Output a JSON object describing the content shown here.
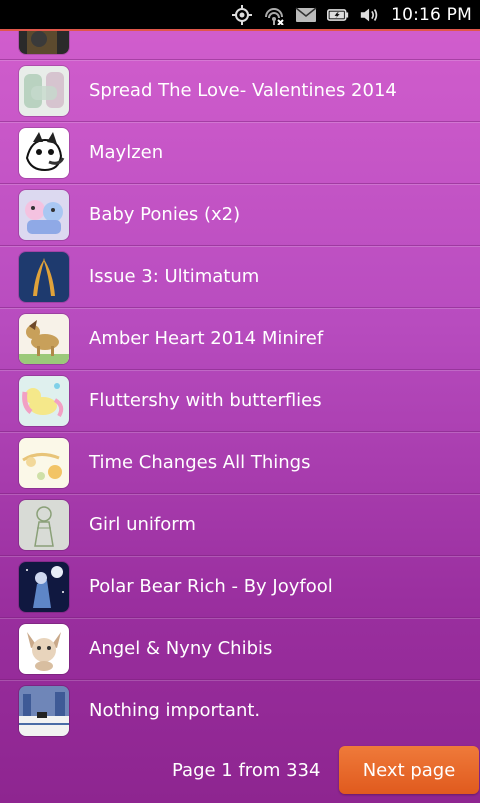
{
  "status_bar": {
    "time": "10:16 PM",
    "icons": [
      "location-icon",
      "network-icon",
      "mail-icon",
      "battery-icon",
      "volume-icon"
    ]
  },
  "list": {
    "items": [
      {
        "title": "",
        "thumb": "dark-art"
      },
      {
        "title": "Spread The Love- Valentines 2014",
        "thumb": "blurred-pastel"
      },
      {
        "title": "Maylzen",
        "thumb": "black-white-pony"
      },
      {
        "title": "Baby Ponies (x2)",
        "thumb": "colorful-ponies"
      },
      {
        "title": "Issue 3: Ultimatum",
        "thumb": "dark-blue-gold"
      },
      {
        "title": "Amber Heart 2014 Miniref",
        "thumb": "brown-pony"
      },
      {
        "title": "Fluttershy with butterflies",
        "thumb": "yellow-pony"
      },
      {
        "title": "Time Changes All Things",
        "thumb": "pale-sketch"
      },
      {
        "title": "Girl uniform",
        "thumb": "green-sketch"
      },
      {
        "title": "Polar Bear Rich - By Joyfool",
        "thumb": "night-scene"
      },
      {
        "title": "Angel & Nyny Chibis",
        "thumb": "fox-chibi"
      },
      {
        "title": "Nothing important.",
        "thumb": "screenshot-scene"
      }
    ]
  },
  "footer": {
    "page_info": "Page 1 from 334",
    "next_label": "Next page"
  },
  "colors": {
    "accent": "#e8642a",
    "background_top": "#d35fce",
    "background_bottom": "#8e2590"
  }
}
